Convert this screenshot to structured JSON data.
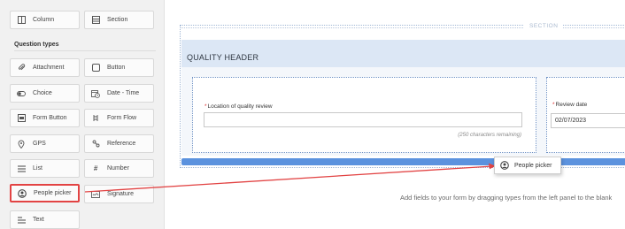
{
  "palette": {
    "accent_blue": "#5b92de",
    "header_band": "#dce7f5",
    "annotation_red": "#e24343"
  },
  "left_panel": {
    "top_tiles": [
      {
        "label": "Column",
        "icon": "column-icon"
      },
      {
        "label": "Section",
        "icon": "section-icon"
      }
    ],
    "question_types_label": "Question types",
    "tiles": [
      {
        "label": "Attachment",
        "icon": "paperclip-icon"
      },
      {
        "label": "Button",
        "icon": "button-icon"
      },
      {
        "label": "Choice",
        "icon": "toggle-icon"
      },
      {
        "label": "Date - Time",
        "icon": "calendar-clock-icon"
      },
      {
        "label": "Form Button",
        "icon": "form-button-icon"
      },
      {
        "label": "Form Flow",
        "icon": "flow-icon"
      },
      {
        "label": "GPS",
        "icon": "location-pin-icon"
      },
      {
        "label": "Reference",
        "icon": "reference-icon"
      },
      {
        "label": "List",
        "icon": "list-icon"
      },
      {
        "label": "Number",
        "icon": "hash-icon"
      },
      {
        "label": "People picker",
        "icon": "person-icon"
      },
      {
        "label": "Signature",
        "icon": "signature-icon"
      },
      {
        "label": "Text",
        "icon": "text-icon"
      }
    ]
  },
  "canvas": {
    "section_label": "SECTION",
    "header_title": "QUALITY HEADER",
    "fields": [
      {
        "required_mark": "*",
        "label": "Location of quality review",
        "value": "",
        "remaining": "(250 characters remaining)"
      },
      {
        "required_mark": "*",
        "label": "Review date",
        "value": "02/07/2023"
      }
    ],
    "hint": "Add fields to your form by dragging types from the left panel to the blank"
  },
  "drag_ghost": {
    "label": "People picker",
    "icon": "person-icon"
  }
}
